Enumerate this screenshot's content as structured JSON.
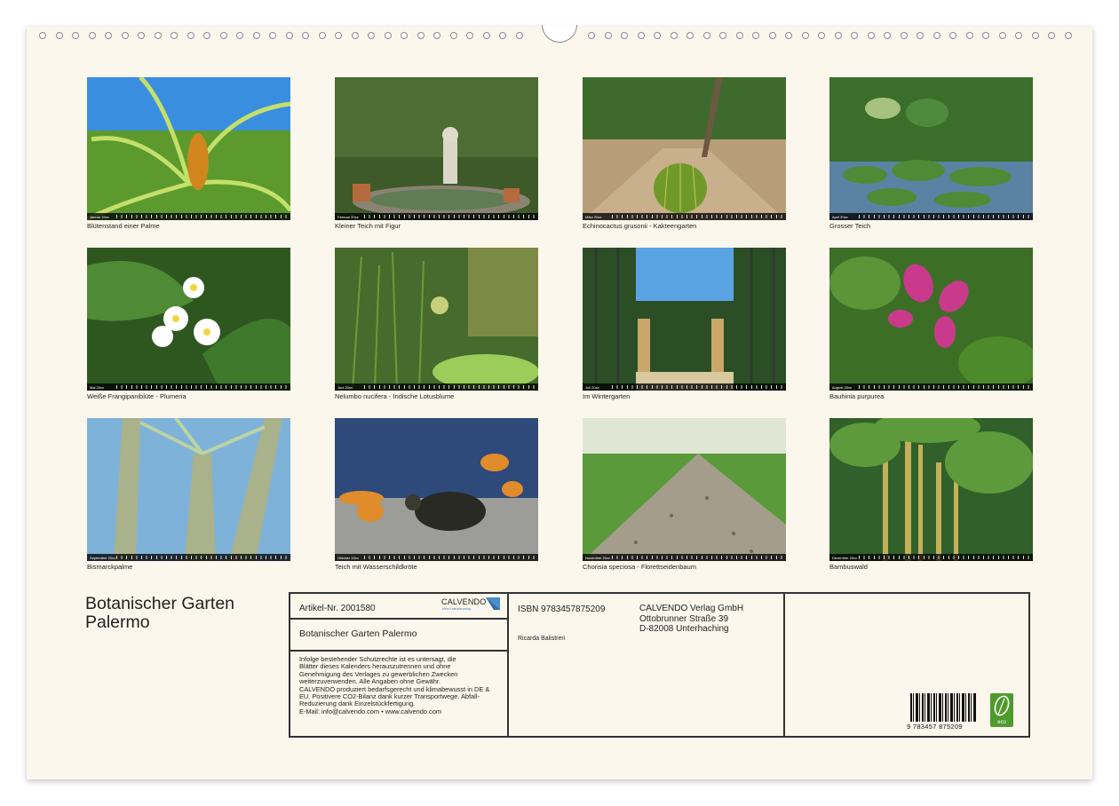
{
  "months": [
    {
      "label": "Januar 20xx",
      "caption": "Blütenstand einer Palme",
      "scene": "palm"
    },
    {
      "label": "Februar 20xx",
      "caption": "Kleiner Teich mit Figur",
      "scene": "statue"
    },
    {
      "label": "März 20xx",
      "caption": "Echinocactus grusonii - Kakteengarten",
      "scene": "cactus"
    },
    {
      "label": "April 20xx",
      "caption": "Grosser Teich",
      "scene": "pond"
    },
    {
      "label": "Mai 20xx",
      "caption": "Weiße Frangipaniblüte - Plumeria",
      "scene": "frangipani"
    },
    {
      "label": "Juni 20xx",
      "caption": "Nelumbo nucifera - Indische Lotusblume",
      "scene": "lotus"
    },
    {
      "label": "Juli 20xx",
      "caption": "Im Wintergarten",
      "scene": "greenhouse"
    },
    {
      "label": "August 20xx",
      "caption": "Bauhinia purpurea",
      "scene": "bauhinia"
    },
    {
      "label": "September 20xx",
      "caption": "Bismarckpalme",
      "scene": "bismarck"
    },
    {
      "label": "Oktober 20xx",
      "caption": "Teich mit Wasserschildkröte",
      "scene": "turtle"
    },
    {
      "label": "November 20xx",
      "caption": "Chorisia speciosa - Florettseidenbaum",
      "scene": "chorisia"
    },
    {
      "label": "Dezember 20xx",
      "caption": "Bambuswald",
      "scene": "bamboo"
    }
  ],
  "title_line1": "Botanischer Garten",
  "title_line2": "Palermo",
  "info": {
    "article": "Artikel-Nr. 2001580",
    "calvendo_logo": "CALVENDO",
    "calvendo_tagline": "Mein Kalenderverlag",
    "book_title": "Botanischer Garten Palermo",
    "legal": "Infolge bestehender Schutzrechte ist es untersagt, die\nBlätter dieses Kalenders herauszutrennen und ohne\nGenehmigung des Verlages zu gewerblichen Zwecken\nweiterzuverwenden. Alle Angaben ohne Gewähr.\nCALVENDO produziert bedarfsgerecht und klimabewusst in DE &\nEU. Positivere CO2-Bilanz dank kurzer Transportwege. Abfall-\nReduzierung dank Einzelstückfertigung.\nE-Mail: info@calvendo.com • www.calvendo.com",
    "isbn": "ISBN 9783457875209",
    "author": "Ricarda Balistreri",
    "publisher_line1": "CALVENDO Verlag GmbH",
    "publisher_line2": "Ottobrunner Straße 39",
    "publisher_line3": "D-82008 Unterhaching",
    "barcode_digits": "9  783457  875209",
    "eco_label": "eco"
  },
  "colors": {
    "paper": "#fcf7ec",
    "frame": "#333333",
    "eco_green": "#4e9a2c"
  }
}
